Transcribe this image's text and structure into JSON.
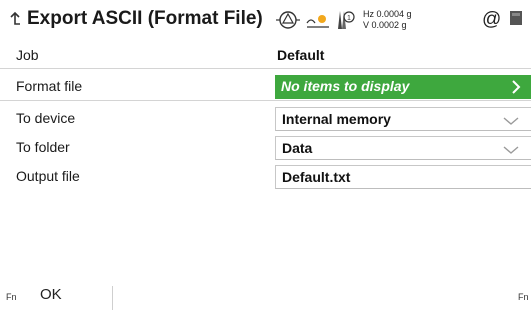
{
  "header": {
    "title": "Export ASCII (Format File)",
    "hz": "Hz 0.0004 g",
    "v": "V  0.0002 g",
    "at_symbol": "@"
  },
  "fields": [
    {
      "label": "Job",
      "value": "Default",
      "kind": "static"
    },
    {
      "label": "Format file",
      "value": "No items to display",
      "kind": "selector"
    },
    {
      "label": "To device",
      "value": "Internal memory",
      "kind": "dropdown"
    },
    {
      "label": "To folder",
      "value": "Data",
      "kind": "dropdown"
    },
    {
      "label": "Output file",
      "value": "Default.txt",
      "kind": "text"
    }
  ],
  "softkeys": {
    "fn_left": "Fn",
    "ok": "OK",
    "fn_right": "Fn"
  },
  "icons": {
    "back": "back-arrow-icon",
    "prism": "prism-target-icon",
    "atr": "atr-lock-icon",
    "tilt": "tilt-compensator-icon",
    "battery": "battery-icon",
    "chevron_right": "chevron-right-icon",
    "chevron_down": "chevron-down-icon"
  },
  "colors": {
    "selected_field": "#3ea83e",
    "text": "#111111",
    "border": "#c7c7c7"
  }
}
